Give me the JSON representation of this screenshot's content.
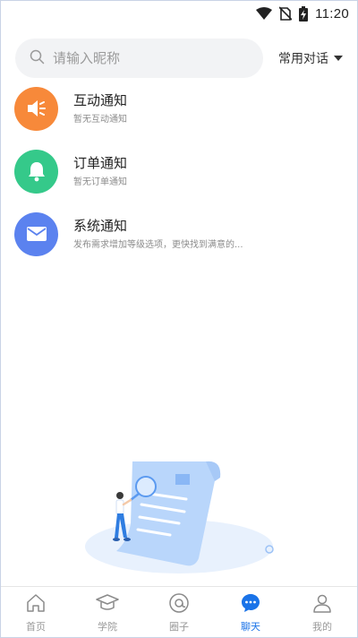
{
  "status_bar": {
    "time": "11:20"
  },
  "search": {
    "placeholder": "请输入昵称",
    "common_phrases_label": "常用对话"
  },
  "notifications": [
    {
      "title": "互动通知",
      "subtitle": "暂无互动通知",
      "icon": "speaker-icon",
      "color": "#f7893a"
    },
    {
      "title": "订单通知",
      "subtitle": "暂无订单通知",
      "icon": "bell-icon",
      "color": "#35c98a"
    },
    {
      "title": "系统通知",
      "subtitle": "发布需求增加等级选项，更快找到满意的...",
      "icon": "mail-icon",
      "color": "#5b82ef"
    }
  ],
  "bottom_nav": {
    "items": [
      {
        "label": "首页",
        "icon": "home-icon"
      },
      {
        "label": "学院",
        "icon": "graduation-cap-icon"
      },
      {
        "label": "圈子",
        "icon": "at-icon"
      },
      {
        "label": "聊天",
        "icon": "chat-bubble-icon",
        "active": true
      },
      {
        "label": "我的",
        "icon": "user-icon"
      }
    ],
    "active_color": "#1a73e8"
  }
}
